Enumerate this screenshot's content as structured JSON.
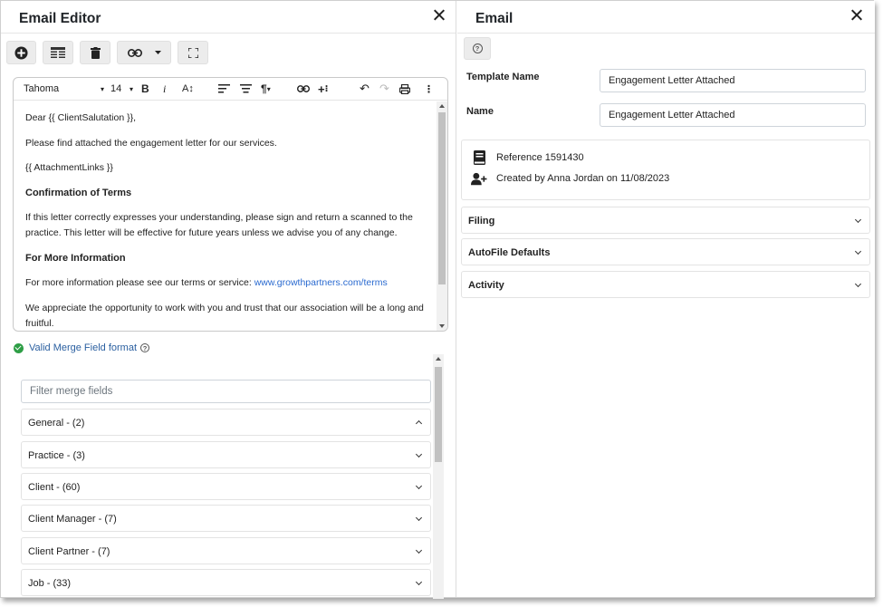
{
  "left": {
    "title": "Email Editor",
    "toolbar": [
      "add-icon",
      "table-icon",
      "trash-icon",
      "link-icon",
      "dropdown-caret-icon",
      "fullscreen-icon"
    ],
    "editor_toolbar": {
      "font": "Tahoma",
      "size": "14",
      "bold": "B",
      "italic": "i",
      "font_size_icon": "A↕"
    },
    "body": {
      "greeting": "Dear {{ ClientSalutation }},",
      "line1": "Please find attached the engagement letter for our services.",
      "line2": "{{ AttachmentLinks }}",
      "heading1": "Confirmation of Terms",
      "para1": "If this letter correctly expresses your understanding, please sign and return a scanned to the practice. This letter will be effective for future years unless we advise you of any change.",
      "heading2": "For More Information",
      "para2_prefix": "For more information please see our terms or service: ",
      "para2_link": "www.growthpartners.com/terms",
      "para3": "We appreciate the opportunity to work with you and trust that our association will be a long and fruitful."
    },
    "valid_text": "Valid Merge Field format",
    "filter_placeholder": "Filter merge fields",
    "groups": [
      {
        "label": "General - (2)",
        "expanded": true
      },
      {
        "label": "Practice - (3)",
        "expanded": false
      },
      {
        "label": "Client - (60)",
        "expanded": false
      },
      {
        "label": "Client Manager - (7)",
        "expanded": false
      },
      {
        "label": "Client Partner - (7)",
        "expanded": false
      },
      {
        "label": "Job - (33)",
        "expanded": false
      }
    ]
  },
  "right": {
    "title": "Email",
    "template_name_label": "Template Name",
    "template_name_value": "Engagement Letter Attached",
    "name_label": "Name",
    "name_value": "Engagement Letter Attached",
    "reference": "Reference 1591430",
    "created": "Created by Anna Jordan on 11/08/2023",
    "sections": [
      "Filing",
      "AutoFile Defaults",
      "Activity"
    ]
  },
  "colors": {
    "accent": "#3cb371",
    "link": "#2a6ad0",
    "valid_check": "#2e9e46"
  }
}
